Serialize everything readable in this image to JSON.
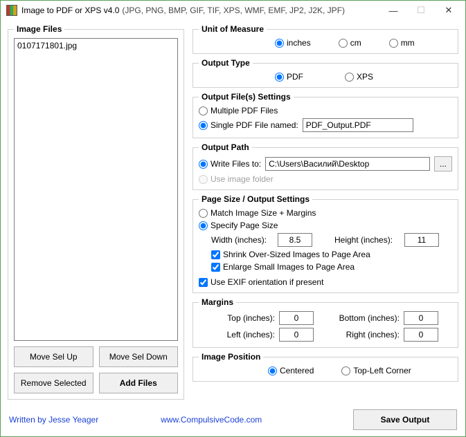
{
  "window": {
    "title": "Image to PDF or XPS  v4.0",
    "subtitle": "(JPG, PNG, BMP, GIF, TIF, XPS, WMF, EMF, JP2, J2K, JPF)"
  },
  "left": {
    "legend": "Image Files",
    "items": [
      "0107171801.jpg"
    ],
    "move_up": "Move Sel Up",
    "move_down": "Move Sel Down",
    "remove": "Remove Selected",
    "add": "Add Files"
  },
  "unit": {
    "legend": "Unit of Measure",
    "inches": "inches",
    "cm": "cm",
    "mm": "mm"
  },
  "output_type": {
    "legend": "Output Type",
    "pdf": "PDF",
    "xps": "XPS"
  },
  "output_files": {
    "legend": "Output File(s) Settings",
    "multiple": "Multiple PDF Files",
    "single": "Single PDF File named:",
    "single_value": "PDF_Output.PDF"
  },
  "output_path": {
    "legend": "Output Path",
    "write_to": "Write Files to:",
    "path_value": "C:\\Users\\Василий\\Desktop",
    "browse": "...",
    "use_image_folder": "Use image folder"
  },
  "page_size": {
    "legend": "Page Size / Output Settings",
    "match": "Match Image Size + Margins",
    "specify": "Specify Page Size",
    "width_label": "Width (inches):",
    "width_value": "8.5",
    "height_label": "Height (inches):",
    "height_value": "11",
    "shrink": "Shrink Over-Sized Images to Page Area",
    "enlarge": "Enlarge Small Images to Page Area",
    "exif": "Use EXIF orientation if present"
  },
  "margins": {
    "legend": "Margins",
    "top": "Top (inches):",
    "top_value": "0",
    "bottom": "Bottom (inches):",
    "bottom_value": "0",
    "left": "Left (inches):",
    "left_value": "0",
    "right": "Right (inches):",
    "right_value": "0"
  },
  "position": {
    "legend": "Image Position",
    "centered": "Centered",
    "topleft": "Top-Left Corner"
  },
  "footer": {
    "written_by": "Written by Jesse Yeager",
    "site": "www.CompulsiveCode.com",
    "save": "Save Output"
  }
}
